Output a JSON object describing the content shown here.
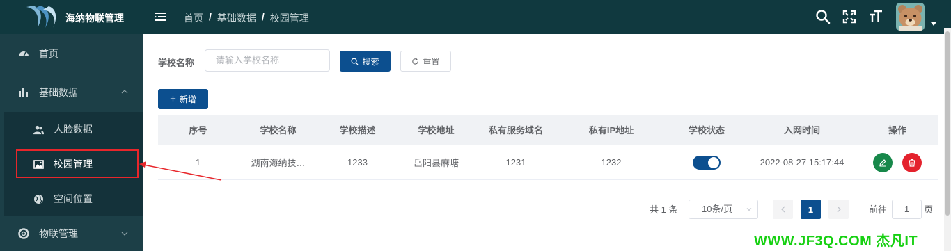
{
  "header": {
    "app_title": "海纳物联管理",
    "breadcrumbs": [
      "首页",
      "基础数据",
      "校园管理"
    ],
    "breadcrumb_separator": "/",
    "icons": [
      "menu-fold-icon",
      "search-icon",
      "fullscreen-icon",
      "font-size-icon",
      "user-avatar",
      "chevron-down-icon"
    ]
  },
  "sidebar": {
    "items": [
      {
        "label": "首页",
        "icon": "dashboard-icon"
      },
      {
        "label": "基础数据",
        "icon": "bar-chart-icon",
        "expanded": true
      },
      {
        "label": "人脸数据",
        "icon": "users-icon"
      },
      {
        "label": "校园管理",
        "icon": "picture-icon",
        "active": true
      },
      {
        "label": "空间位置",
        "icon": "globe-icon"
      },
      {
        "label": "物联管理",
        "icon": "lifebuoy-icon",
        "expanded": false
      }
    ]
  },
  "search_form": {
    "label": "学校名称",
    "placeholder": "请输入学校名称",
    "search_label": "搜索",
    "reset_label": "重置"
  },
  "toolbar": {
    "add_label": "新增"
  },
  "table": {
    "columns": [
      "序号",
      "学校名称",
      "学校描述",
      "学校地址",
      "私有服务域名",
      "私有IP地址",
      "学校状态",
      "入网时间",
      "操作"
    ],
    "rows": [
      {
        "index": "1",
        "name": "湖南海纳技…",
        "description": "1233",
        "address": "岳阳县麻塘",
        "domain": "1231",
        "ip": "1232",
        "status_on": true,
        "joined": "2022-08-27 15:17:44"
      }
    ]
  },
  "pagination": {
    "total_text": "共 1 条",
    "page_size": "10条/页",
    "current_page": "1",
    "goto_label": "前往",
    "goto_value": "1",
    "goto_unit": "页"
  },
  "watermark": "WWW.JF3Q.COM 杰凡IT",
  "colors": {
    "topbar": "#10393f",
    "sidebar": "#1c3f47",
    "primary": "#0c4f8f",
    "edit": "#17884a",
    "delete": "#e4222d",
    "highlight": "#e8262b",
    "watermark": "#16d011"
  }
}
